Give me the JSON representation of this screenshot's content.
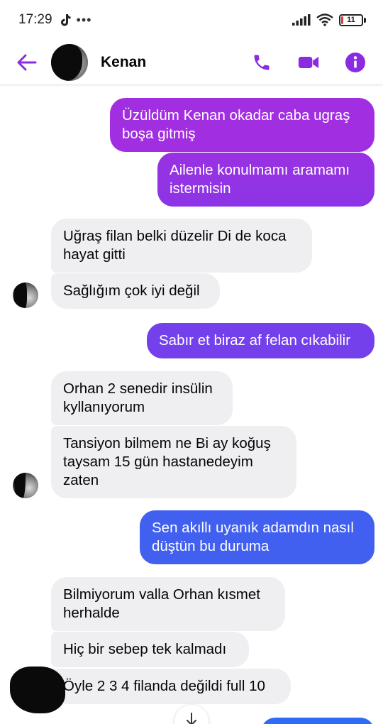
{
  "status_bar": {
    "time": "17:29",
    "dots": "•••",
    "battery_level": "11",
    "battery_fraction": 0.11,
    "icons": [
      "tiktok-icon",
      "signal-icon",
      "wifi-icon",
      "battery-icon"
    ]
  },
  "header": {
    "contact_name": "Kenan",
    "icons": [
      "back-arrow-icon",
      "phone-icon",
      "video-camera-icon",
      "info-icon"
    ],
    "accent_color": "#8a2be2"
  },
  "messages": [
    {
      "side": "out",
      "text": "Üzüldüm Kenan okadar caba ugraş boşa gitmiş"
    },
    {
      "side": "out",
      "text": "Ailenle konulmamı aramamı istermisin"
    },
    {
      "side": "in",
      "text": "Uğraş filan belki düzelir Di de koca hayat gitti"
    },
    {
      "side": "in",
      "text": "Sağlığım çok iyi değil"
    },
    {
      "side": "out",
      "text": "Sabır et biraz af felan cıkabilir"
    },
    {
      "side": "in",
      "text": "Orhan 2 senedir insülin kyllanıyorum"
    },
    {
      "side": "in",
      "text": "Tansiyon bilmem ne Bi ay koğuş taysam 15 gün hastanedeyim zaten"
    },
    {
      "side": "out",
      "text": "Sen akıllı uyanık adamdın nasıl düştün bu duruma"
    },
    {
      "side": "in",
      "text": "Bilmiyorum valla Orhan kısmet herhalde"
    },
    {
      "side": "in",
      "text": "Hiç bir sebep tek kalmadı"
    },
    {
      "side": "in",
      "text": "Öyle 2 3 4 filanda değildi full 10"
    }
  ],
  "colors": {
    "outgoing_gradient_top": "#a12ee0",
    "outgoing_gradient_mid": "#7c3aed",
    "outgoing_gradient_bottom": "#3d66f0",
    "incoming_bg": "#efeff2"
  },
  "scroll_down_icon": "arrow-down-icon"
}
